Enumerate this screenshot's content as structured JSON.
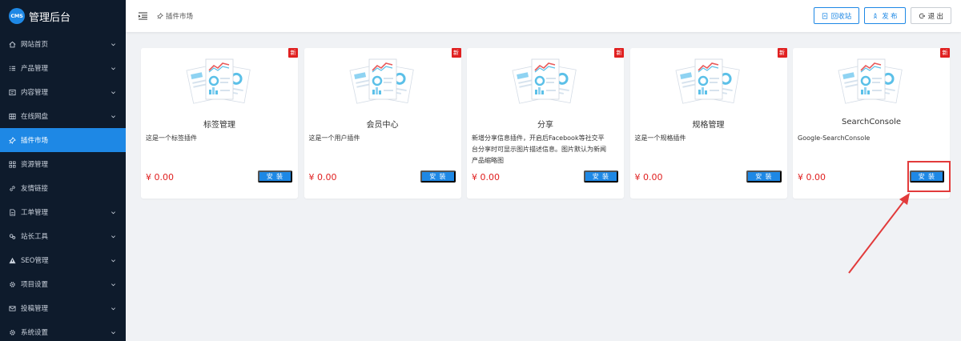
{
  "app": {
    "logo_badge": "CMS",
    "title": "管理后台"
  },
  "sidebar": {
    "items": [
      {
        "label": "网站首页",
        "icon": "home-icon",
        "active": false,
        "has_children": true
      },
      {
        "label": "产品管理",
        "icon": "list-icon",
        "active": false,
        "has_children": true
      },
      {
        "label": "内容管理",
        "icon": "document-icon",
        "active": false,
        "has_children": true
      },
      {
        "label": "在线网盘",
        "icon": "grid-icon",
        "active": false,
        "has_children": true
      },
      {
        "label": "插件市场",
        "icon": "pin-icon",
        "active": true,
        "has_children": false
      },
      {
        "label": "资源管理",
        "icon": "apps-icon",
        "active": false,
        "has_children": false
      },
      {
        "label": "友情链接",
        "icon": "link-icon",
        "active": false,
        "has_children": false
      },
      {
        "label": "工单管理",
        "icon": "ticket-icon",
        "active": false,
        "has_children": true
      },
      {
        "label": "站长工具",
        "icon": "tools-icon",
        "active": false,
        "has_children": true
      },
      {
        "label": "SEO管理",
        "icon": "warning-icon",
        "active": false,
        "has_children": true
      },
      {
        "label": "项目设置",
        "icon": "gear-icon",
        "active": false,
        "has_children": true
      },
      {
        "label": "投稿管理",
        "icon": "mail-icon",
        "active": false,
        "has_children": true
      },
      {
        "label": "系统设置",
        "icon": "gear-icon",
        "active": false,
        "has_children": true
      }
    ]
  },
  "header": {
    "breadcrumb": "插件市场",
    "actions": [
      {
        "label": "回收站",
        "icon": "recycle-icon"
      },
      {
        "label": "发 布",
        "icon": "publish-icon"
      },
      {
        "label": "退 出",
        "icon": "logout-icon"
      }
    ]
  },
  "plugins": [
    {
      "title": "标签管理",
      "description": "这是一个标签插件",
      "price": "¥ 0.00",
      "badge": "新",
      "action": "安 装"
    },
    {
      "title": "会员中心",
      "description": "这是一个用户插件",
      "price": "¥ 0.00",
      "badge": "新",
      "action": "安 装"
    },
    {
      "title": "分享",
      "description": "新增分享信息插件，开启后Facebook等社交平台分享时可显示图片描述信息。图片默认为新闻产品缩略图",
      "price": "¥ 0.00",
      "badge": "新",
      "action": "安 装"
    },
    {
      "title": "规格管理",
      "description": "这是一个规格插件",
      "price": "¥ 0.00",
      "badge": "新",
      "action": "安 装"
    },
    {
      "title": "SearchConsole",
      "description": "Google-SearchConsole",
      "price": "¥ 0.00",
      "badge": "新",
      "action": "安 装"
    }
  ],
  "colors": {
    "sidebar_bg": "#0e1b2c",
    "accent": "#1e88e5",
    "price": "#e02020",
    "annotation": "#e23b3b"
  }
}
